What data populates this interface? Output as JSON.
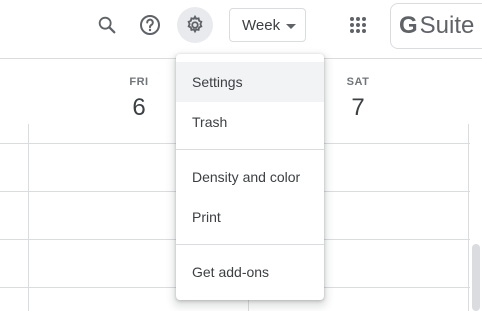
{
  "toolbar": {
    "view_selector": {
      "value": "Week"
    },
    "brand": {
      "logo_letter": "G",
      "text": "Suite"
    }
  },
  "calendar": {
    "days": [
      {
        "name": "FRI",
        "number": "6"
      },
      {
        "name": "SAT",
        "number": "7"
      }
    ]
  },
  "settings_menu": {
    "items": [
      {
        "label": "Settings",
        "highlighted": true
      },
      {
        "label": "Trash"
      },
      {
        "label": "Density and color"
      },
      {
        "label": "Print"
      },
      {
        "label": "Get add-ons"
      }
    ]
  },
  "icons": [
    "search-icon",
    "help-icon",
    "gear-icon",
    "apps-grid-icon",
    "dropdown-caret-icon"
  ],
  "colors": {
    "border": "#dadce0",
    "menu_hover": "#f1f3f4",
    "text": "#3c4043",
    "icon": "#5f6368"
  }
}
